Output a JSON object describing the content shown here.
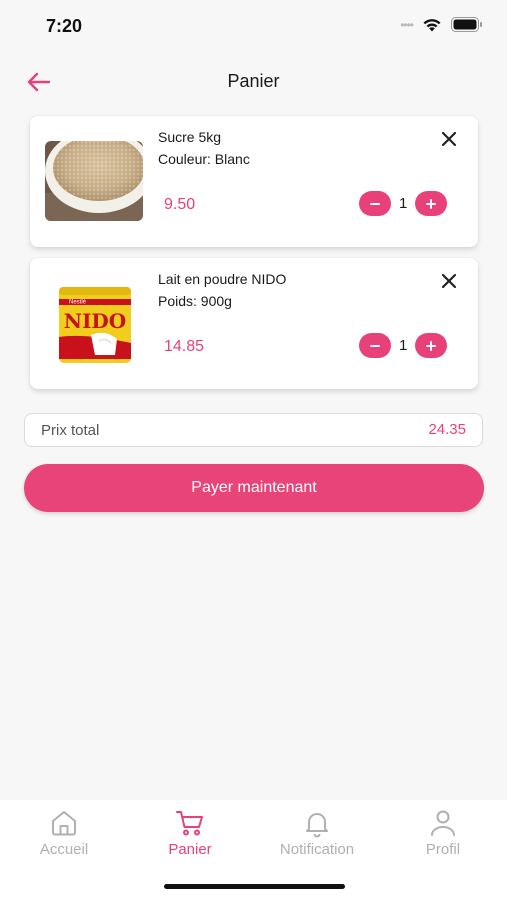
{
  "status_bar": {
    "time": "7:20",
    "signal_dots": "••••"
  },
  "header": {
    "title": "Panier",
    "back_icon": "arrow-left-icon"
  },
  "colors": {
    "accent": "#e8417a",
    "background": "#f7f7f7",
    "nav_inactive": "#b0b0b0"
  },
  "cart": {
    "items": [
      {
        "name": "Sucre 5kg",
        "attribute": "Couleur: Blanc",
        "price": "9.50",
        "quantity": "1",
        "image": "sugar-bowl"
      },
      {
        "name": "Lait en poudre NIDO",
        "attribute": "Poids: 900g",
        "price": "14.85",
        "quantity": "1",
        "image": "nido-can",
        "brand": "NIDO",
        "brand_top": "Nestlé"
      }
    ]
  },
  "total": {
    "label": "Prix total",
    "value": "24.35"
  },
  "pay_button": {
    "label": "Payer maintenant"
  },
  "nav": {
    "items": [
      {
        "label": "Accueil",
        "icon": "home-icon",
        "active": false
      },
      {
        "label": "Panier",
        "icon": "cart-icon",
        "active": true
      },
      {
        "label": "Notification",
        "icon": "bell-icon",
        "active": false
      },
      {
        "label": "Profil",
        "icon": "user-icon",
        "active": false
      }
    ]
  }
}
